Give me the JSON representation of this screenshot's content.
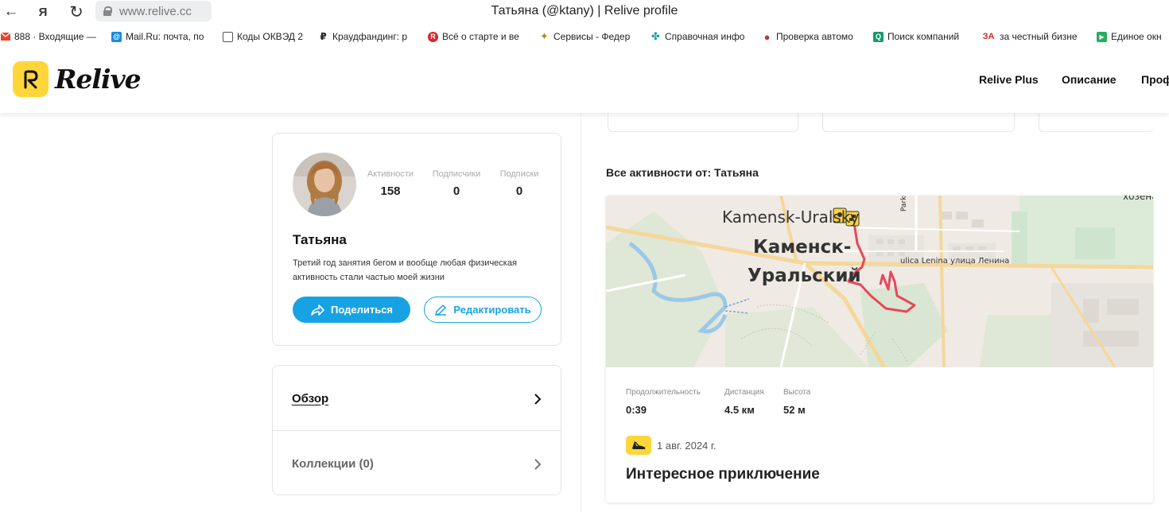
{
  "browser": {
    "url": "www.relive.cc",
    "tab_title": "Татьяна (@ktany) | Relive profile",
    "back_glyph": "←",
    "yandex_glyph": "Я",
    "reload_glyph": "↻",
    "bookmarks": [
      {
        "label": "888 · Входящие —",
        "icon": "mail-icon",
        "color": "#e8432b",
        "glyph": ""
      },
      {
        "label": "Mail.Ru: почта, по",
        "icon": "mailru-icon",
        "color": "#168de2",
        "glyph": "@"
      },
      {
        "label": "Коды ОКВЭД 2",
        "icon": "document-icon",
        "color": "#555555",
        "glyph": ""
      },
      {
        "label": "Краудфандинг: р",
        "icon": "ruble-icon",
        "color": "#222222",
        "glyph": "₽"
      },
      {
        "label": "Всё о старте и ве",
        "icon": "r-badge-icon",
        "color": "#d7262b",
        "glyph": "R"
      },
      {
        "label": "Сервисы - Федер",
        "icon": "emblem-icon",
        "color": "#b08a2e",
        "glyph": "✦"
      },
      {
        "label": "Справочная инфо",
        "icon": "pinwheel-icon",
        "color": "#1aa0a0",
        "glyph": "✤"
      },
      {
        "label": "Проверка автомо",
        "icon": "police-icon",
        "color": "#c0392b",
        "glyph": "●"
      },
      {
        "label": "Поиск компаний",
        "icon": "search-company-icon",
        "color": "#1a9a6c",
        "glyph": "Q"
      },
      {
        "label": "за честный бизне",
        "icon": "za-icon",
        "color": "#ffffff",
        "glyph": "ЗА"
      },
      {
        "label": "Единое окн",
        "icon": "window-icon",
        "color": "#27ae60",
        "glyph": "▶"
      }
    ]
  },
  "header": {
    "logo_text": "Relive",
    "nav": [
      "Relive Plus",
      "Описание",
      "Проф"
    ]
  },
  "profile": {
    "stats": [
      {
        "label": "Активности",
        "value": "158"
      },
      {
        "label": "Подписчики",
        "value": "0"
      },
      {
        "label": "Подписки",
        "value": "0"
      }
    ],
    "name": "Татьяна",
    "bio": "Третий год занятия бегом и вообще любая физическая активность стали частью моей жизни",
    "share_label": "Поделиться",
    "edit_label": "Редактировать"
  },
  "profile_nav": {
    "overview_label": "Обзор",
    "collections_label": "Коллекции",
    "collections_count": "(0)"
  },
  "feed": {
    "section_title": "Все активности от: Татьяна",
    "activity": {
      "map_labels": {
        "city_en": "Kamensk-Uralsky",
        "city_ru_1": "Каменск-",
        "city_ru_2": "Уральский",
        "street": "ulica Lenina улица Ленина",
        "parkova": "Parkovaâ",
        "corner": "хозенс"
      },
      "metrics": [
        {
          "label": "Продолжительность",
          "value": "0:39"
        },
        {
          "label": "Дистанция",
          "value": "4.5 км"
        },
        {
          "label": "Высота",
          "value": "52 м"
        }
      ],
      "date": "1 авг. 2024 г.",
      "title": "Интересное приключение"
    }
  },
  "colors": {
    "brand_yellow": "#ffd63a",
    "accent_blue": "#17a3e3",
    "route_red": "#e8475a"
  }
}
